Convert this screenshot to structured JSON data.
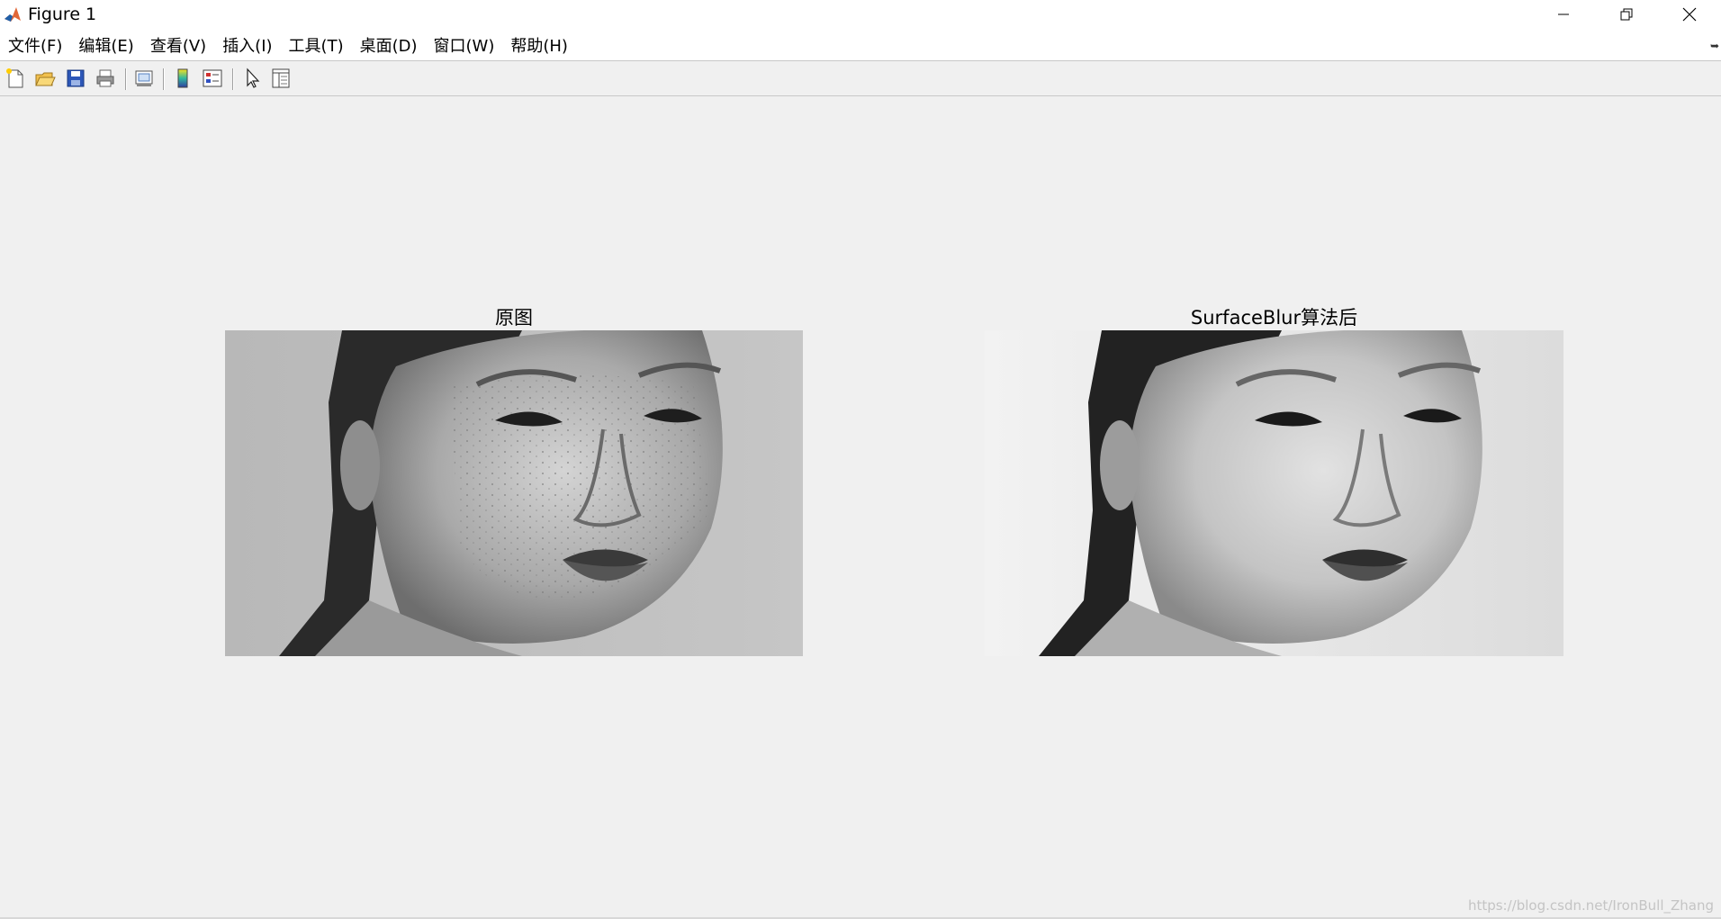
{
  "window": {
    "title": "Figure 1",
    "minimize_glyph": "—",
    "restore_glyph": "❐",
    "close_glyph": "✕"
  },
  "menu": {
    "items": [
      {
        "label": "文件(F)"
      },
      {
        "label": "编辑(E)"
      },
      {
        "label": "查看(V)"
      },
      {
        "label": "插入(I)"
      },
      {
        "label": "工具(T)"
      },
      {
        "label": "桌面(D)"
      },
      {
        "label": "窗口(W)"
      },
      {
        "label": "帮助(H)"
      }
    ]
  },
  "toolbar": {
    "icons": [
      "new-figure-icon",
      "open-file-icon",
      "save-icon",
      "print-icon",
      "link-plot-icon",
      "insert-colorbar-icon",
      "insert-legend-icon",
      "edit-plot-pointer-icon",
      "property-inspector-icon"
    ]
  },
  "axes": [
    {
      "title": "原图",
      "image": "grayscale portrait photo of a woman with freckles"
    },
    {
      "title": "SurfaceBlur算法后",
      "image": "same portrait after surface blur smoothing"
    }
  ],
  "watermark": "https://blog.csdn.net/IronBull_Zhang",
  "colors": {
    "background": "#f0f0f0",
    "titlebar": "#ffffff",
    "matlab_orange": "#e16737",
    "matlab_blue": "#1f5fa8"
  }
}
